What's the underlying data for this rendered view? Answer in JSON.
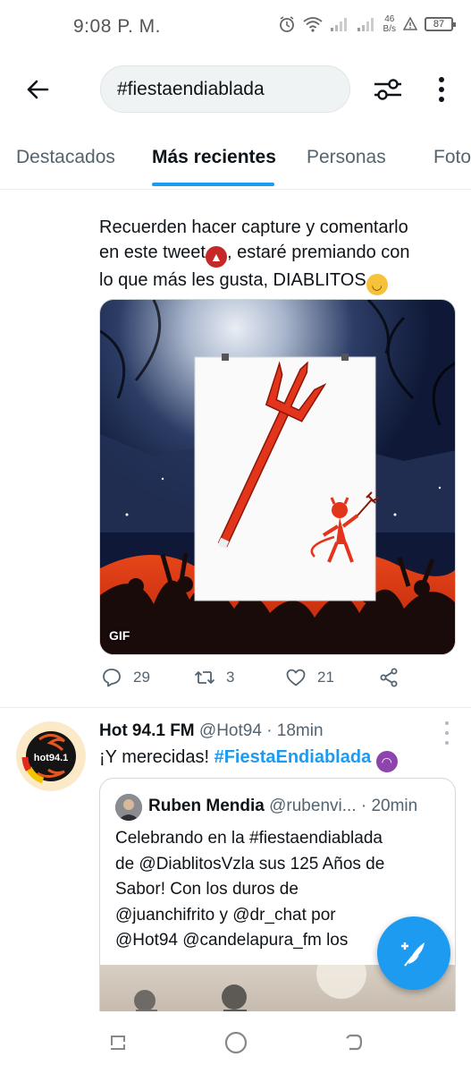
{
  "status_bar": {
    "time": "9:08 P. M.",
    "net_speed_value": "46",
    "net_speed_unit": "B/s",
    "battery": "87",
    "icons": [
      "alarm-icon",
      "wifi-icon",
      "signal-icon",
      "signal-icon",
      "warning-icon",
      "battery-icon"
    ]
  },
  "top_bar": {
    "search_query": "#fiestaendiablada",
    "icons": [
      "back-arrow-icon",
      "filter-sliders-icon",
      "more-vertical-icon"
    ]
  },
  "tabs": [
    {
      "label": "Destacados",
      "active": false
    },
    {
      "label": "Más recientes",
      "active": true
    },
    {
      "label": "Personas",
      "active": false
    },
    {
      "label": "Foto",
      "active": false
    }
  ],
  "tweet1": {
    "text_line1": "Recuerden hacer capture y comentarlo",
    "text_line2a": "en este tweet",
    "text_line2b": ", estaré premiando con",
    "text_line3": "lo que más les gusta, DIABLITOS",
    "media_badge": "GIF",
    "reply_count": "29",
    "retweet_count": "3",
    "like_count": "21"
  },
  "tweet2": {
    "author_name": "Hot 94.1 FM",
    "author_handle": "@Hot94",
    "separator": "·",
    "time": "18min",
    "text_plain": "¡Y merecidas! ",
    "text_hashtag": "#FiestaEndiablada",
    "avatar_text": "hot94.1",
    "quote": {
      "author_name": "Ruben Mendia",
      "author_handle": "@rubenvi...",
      "separator": "·",
      "time": "20min",
      "text_line1": "Celebrando en la #fiestaendiablada",
      "text_line2": "de @DiablitosVzla sus 125 Años de",
      "text_line3": "Sabor! Con los duros de",
      "text_line4": "@juanchifrito y @dr_chat por",
      "text_line5": "@Hot94 @candelapura_fm los"
    }
  },
  "colors": {
    "accent": "#1d9bf0",
    "text_primary": "#0f1419",
    "text_secondary": "#536471"
  }
}
